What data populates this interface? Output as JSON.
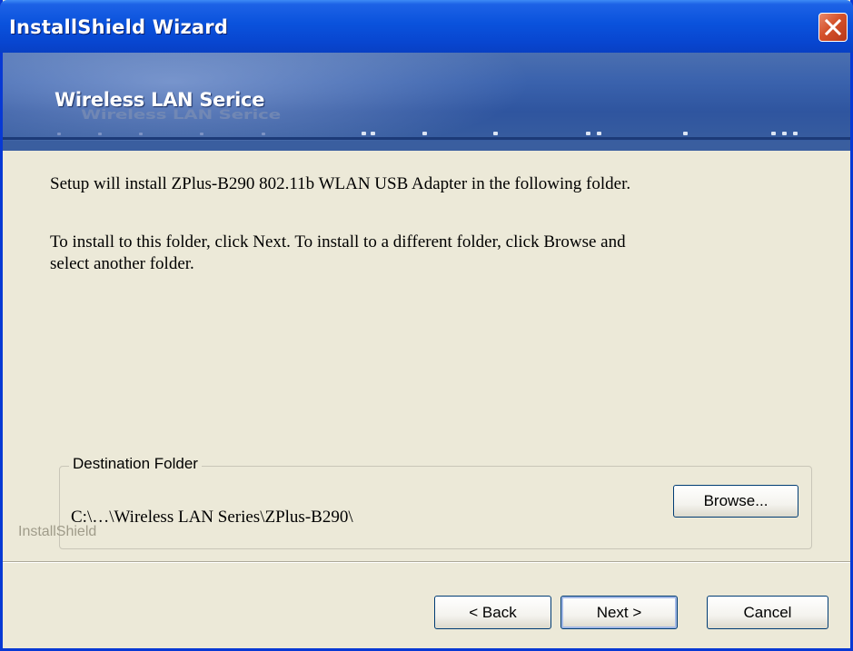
{
  "window": {
    "title": "InstallShield Wizard"
  },
  "banner": {
    "title": "Wireless LAN Serice"
  },
  "body": {
    "line1": "Setup will install ZPlus-B290 802.11b WLAN USB Adapter in the following folder.",
    "line2": "To install to this folder, click Next. To install to a different folder, click Browse and",
    "line3": "select another folder."
  },
  "destination": {
    "label": "Destination Folder",
    "path": "C:\\…\\Wireless LAN Series\\ZPlus-B290\\",
    "browse_label": "Browse..."
  },
  "brand": "InstallShield",
  "buttons": {
    "back": "< Back",
    "next": "Next >",
    "cancel": "Cancel"
  },
  "icons": {
    "close": "close-icon"
  },
  "colors": {
    "titlebar": "#0a52dc",
    "close": "#d4512a",
    "panel": "#ece9d8"
  }
}
